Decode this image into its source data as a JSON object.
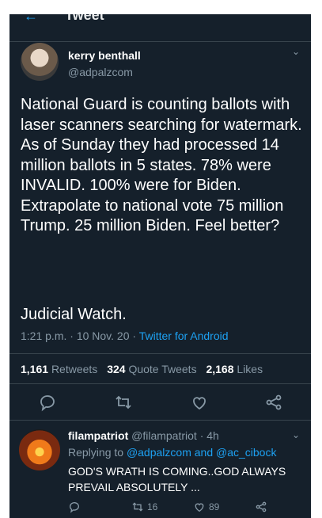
{
  "header": {
    "title": "Tweet"
  },
  "tweet": {
    "display_name": "kerry benthall",
    "handle": "@adpalzcom",
    "text": "National Guard is counting ballots with laser scanners searching for watermark. As of Sunday they had processed 14 million ballots in 5 states. 78% were INVALID. 100% were for Biden. Extrapolate to national vote 75 million Trump. 25 million Biden. Feel better?",
    "signature": "Judicial Watch.",
    "time": "1:21 p.m.",
    "sep1": "·",
    "date": "10 Nov. 20",
    "sep2": "·",
    "source": "Twitter for Android",
    "stats": {
      "retweets_count": "1,161",
      "retweets_label": "Retweets",
      "quotes_count": "324",
      "quotes_label": "Quote Tweets",
      "likes_count": "2,168",
      "likes_label": "Likes"
    }
  },
  "reply": {
    "display_name": "filampatriot",
    "handle": "@filampatriot",
    "sep": "·",
    "age": "4h",
    "replying_prefix": "Replying to",
    "mention1": "@adpalzcom",
    "and": "and",
    "mention2": "@ac_cibock",
    "text": "GOD'S WRATH IS COMING..GOD ALWAYS PREVAIL ABSOLUTELY ...",
    "retweets": "16",
    "likes": "89"
  },
  "colors": {
    "background": "#15202b",
    "text": "#ffffff",
    "secondary": "#8899a6",
    "accent": "#1da1f2",
    "divider": "#38444d"
  },
  "icons": [
    "back-arrow-icon",
    "chevron-down-icon",
    "reply-icon",
    "retweet-icon",
    "like-icon",
    "share-icon"
  ]
}
